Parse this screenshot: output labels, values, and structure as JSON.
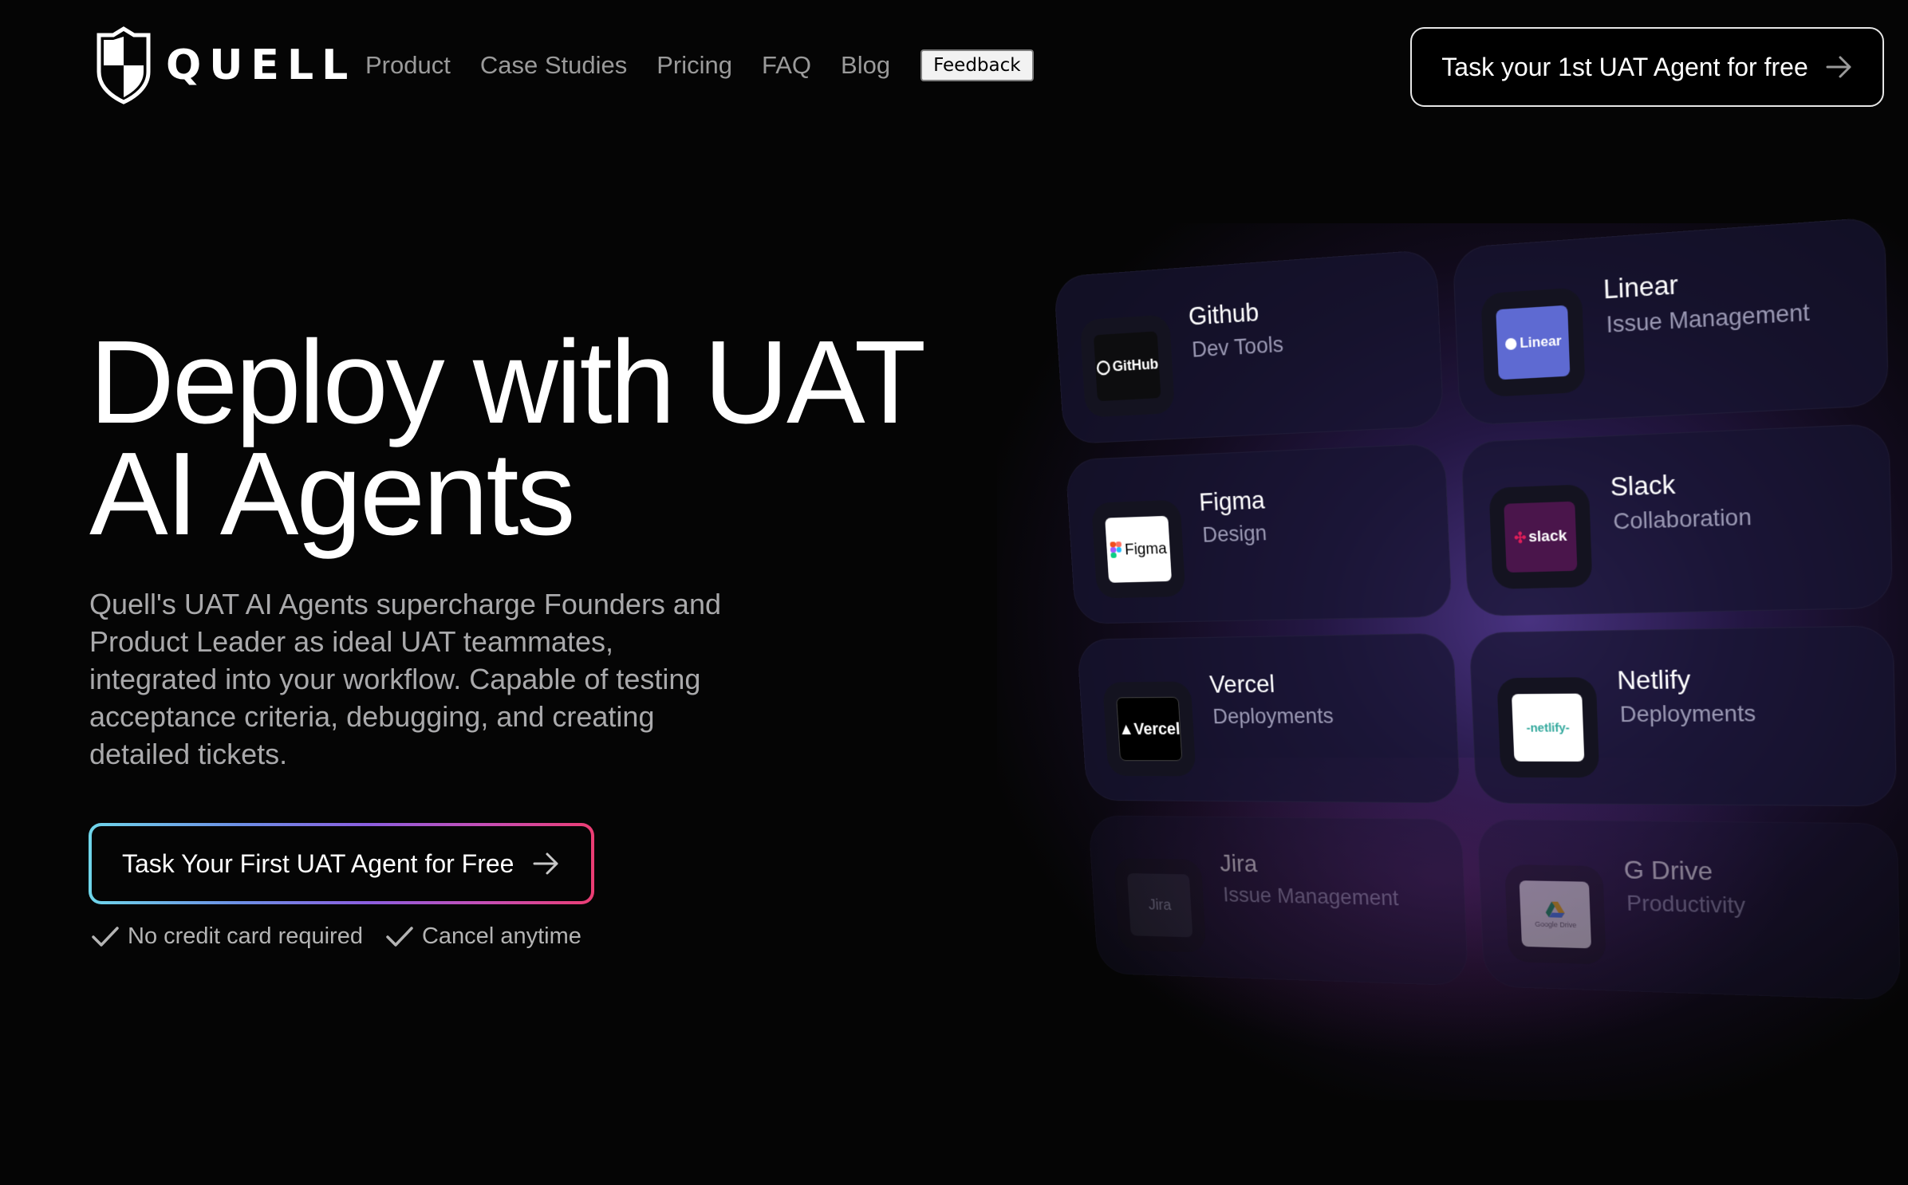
{
  "brand": {
    "name": "QUELL"
  },
  "nav": {
    "links": [
      "Product",
      "Case Studies",
      "Pricing",
      "FAQ",
      "Blog"
    ],
    "feedback_label": "Feedback",
    "cta_label": "Task your 1st UAT Agent for free"
  },
  "hero": {
    "title_line1": "Deploy with UAT",
    "title_line2": "AI Agents",
    "description": "Quell's UAT AI Agents supercharge Founders and Product Leader as ideal UAT teammates, integrated into your workflow. Capable of testing acceptance criteria, debugging, and creating detailed tickets.",
    "cta_label": "Task Your First UAT Agent for Free",
    "checks": [
      "No credit card required",
      "Cancel anytime"
    ]
  },
  "integrations": [
    {
      "name": "Github",
      "category": "Dev Tools",
      "logo_text": "GitHub",
      "logo_bg": "#0d0d0f",
      "logo_fg": "#ffffff",
      "icon": "github-icon"
    },
    {
      "name": "Linear",
      "category": "Issue Management",
      "logo_text": "Linear",
      "logo_bg": "#5e6ad2",
      "logo_fg": "#ffffff",
      "icon": "linear-icon"
    },
    {
      "name": "Figma",
      "category": "Design",
      "logo_text": "Figma",
      "logo_bg": "#ffffff",
      "logo_fg": "#000000",
      "icon": "figma-icon"
    },
    {
      "name": "Slack",
      "category": "Collaboration",
      "logo_text": "slack",
      "logo_bg": "#4a154b",
      "logo_fg": "#ffffff",
      "icon": "slack-icon"
    },
    {
      "name": "Vercel",
      "category": "Deployments",
      "logo_text": "▲Vercel",
      "logo_bg": "#000000",
      "logo_fg": "#ffffff",
      "icon": "vercel-icon"
    },
    {
      "name": "Netlify",
      "category": "Deployments",
      "logo_text": "-netlify-",
      "logo_bg": "#ffffff",
      "logo_fg": "#0e1e25",
      "icon": "netlify-icon"
    },
    {
      "name": "Jira",
      "category": "Issue Management",
      "logo_text": "Jira",
      "logo_bg": "#2a2a3a",
      "logo_fg": "#9fa3b8",
      "icon": "jira-icon"
    },
    {
      "name": "G Drive",
      "category": "Productivity",
      "logo_text": "Google Drive",
      "logo_bg": "#f2f2f2",
      "logo_fg": "#666666",
      "icon": "google-drive-icon"
    }
  ],
  "colors": {
    "background": "#050505",
    "cta_gradient": [
      "#6fd6ea",
      "#8b5fe0",
      "#ec3d73"
    ],
    "glow": "#8058e6"
  }
}
